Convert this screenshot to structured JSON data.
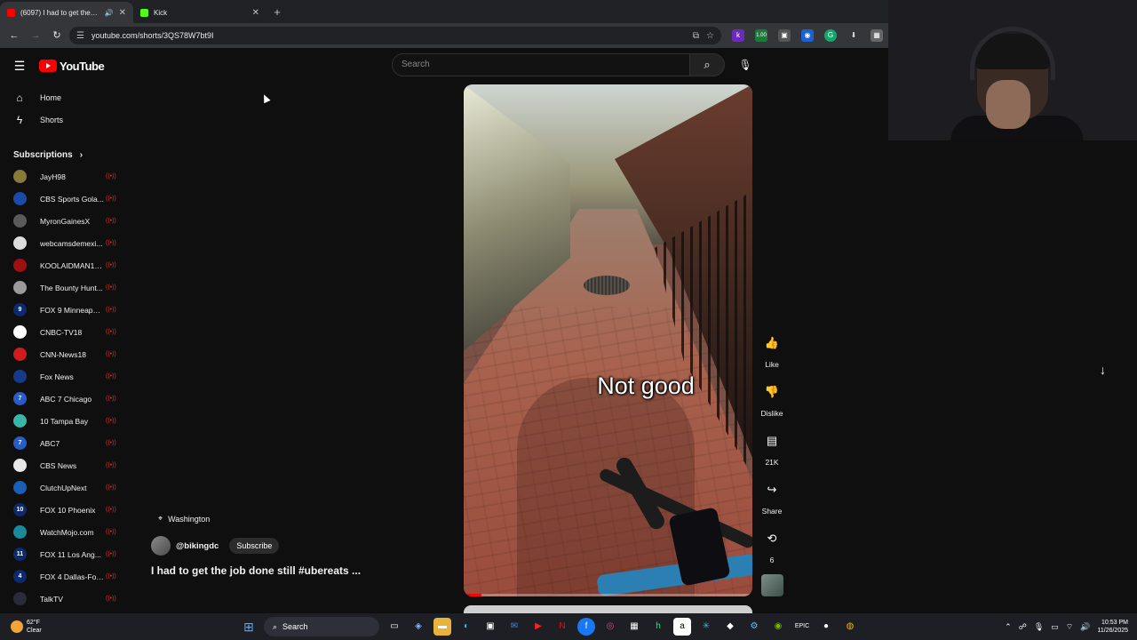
{
  "browser": {
    "tabs": [
      {
        "title": "(6097) I had to get the job",
        "active": true,
        "favicon_color": "#ff0000"
      },
      {
        "title": "Kick",
        "active": false,
        "favicon_color": "#53fc18"
      }
    ],
    "url": "youtube.com/shorts/3QS78W7bt9I"
  },
  "youtube": {
    "logo_text": "YouTube",
    "search_placeholder": "Search",
    "nav": [
      {
        "label": "Home",
        "icon": "home-icon"
      },
      {
        "label": "Shorts",
        "icon": "shorts-icon"
      }
    ],
    "subscriptions_label": "Subscriptions",
    "subscriptions": [
      {
        "name": "JayH98",
        "color": "#8a7a3a",
        "initial": ""
      },
      {
        "name": "CBS Sports Gola...",
        "color": "#1c4aa8",
        "initial": ""
      },
      {
        "name": "MyronGainesX",
        "color": "#5a5a5a",
        "initial": ""
      },
      {
        "name": "webcamsdemexi...",
        "color": "#dddddd",
        "initial": ""
      },
      {
        "name": "KOOLAIDMAN10...",
        "color": "#a01010",
        "initial": ""
      },
      {
        "name": "The Bounty Hunt...",
        "color": "#9a9a9a",
        "initial": ""
      },
      {
        "name": "FOX 9 Minneapol...",
        "color": "#0e2a6e",
        "initial": "9"
      },
      {
        "name": "CNBC-TV18",
        "color": "#ffffff",
        "initial": ""
      },
      {
        "name": "CNN-News18",
        "color": "#d01c1c",
        "initial": ""
      },
      {
        "name": "Fox News",
        "color": "#163a8a",
        "initial": ""
      },
      {
        "name": "ABC 7 Chicago",
        "color": "#2a5cc8",
        "initial": "7"
      },
      {
        "name": "10 Tampa Bay",
        "color": "#3ab6a8",
        "initial": ""
      },
      {
        "name": "ABC7",
        "color": "#2a5cc8",
        "initial": "7"
      },
      {
        "name": "CBS News",
        "color": "#e8e8e8",
        "initial": ""
      },
      {
        "name": "ClutchUpNext",
        "color": "#1a5fb4",
        "initial": ""
      },
      {
        "name": "FOX 10 Phoenix",
        "color": "#0e2a6e",
        "initial": "10"
      },
      {
        "name": "WatchMojo.com",
        "color": "#1a8a9a",
        "initial": ""
      },
      {
        "name": "FOX 11 Los Ang...",
        "color": "#0e2a6e",
        "initial": "11"
      },
      {
        "name": "FOX 4 Dallas-For...",
        "color": "#0e2a6e",
        "initial": "4"
      },
      {
        "name": "TalkTV",
        "color": "#2a2a3a",
        "initial": ""
      }
    ],
    "short": {
      "caption": "Not good",
      "location": "Washington",
      "channel": "@bikingdc",
      "subscribe_label": "Subscribe",
      "title": "I had to get the job done still #ubereats ...",
      "progress": 0.06
    },
    "actions": [
      {
        "label": "Like",
        "icon": "thumbs-up-icon"
      },
      {
        "label": "Dislike",
        "icon": "thumbs-down-icon"
      },
      {
        "label": "21K",
        "icon": "comment-icon"
      },
      {
        "label": "Share",
        "icon": "share-icon"
      },
      {
        "label": "6",
        "icon": "remix-icon"
      }
    ]
  },
  "taskbar": {
    "weather_temp": "62°F",
    "weather_desc": "Clear",
    "search_label": "Search",
    "time": "10:53 PM",
    "date": "11/26/2025"
  }
}
